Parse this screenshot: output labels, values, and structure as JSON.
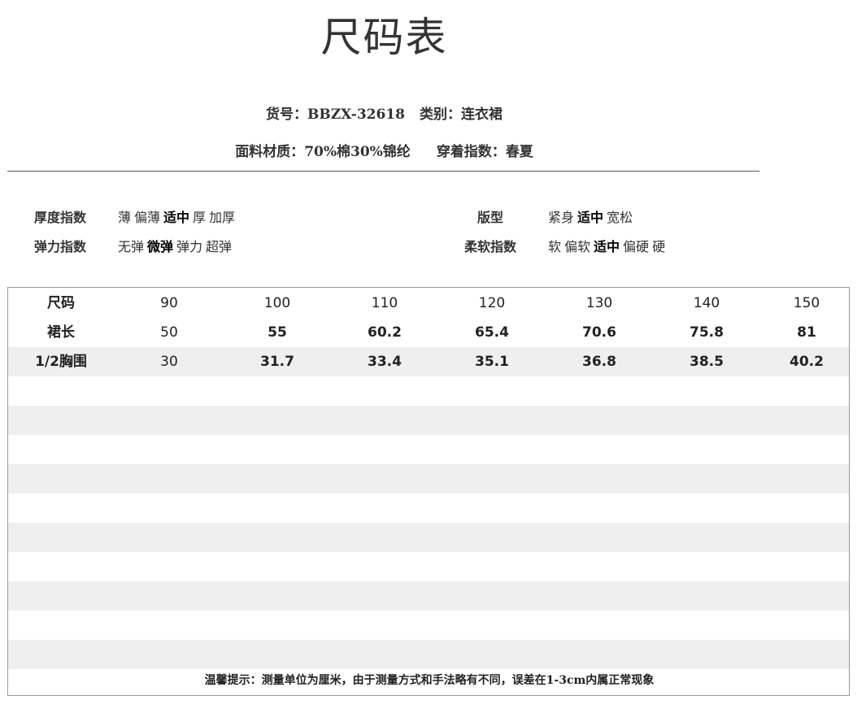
{
  "title": "尺码表",
  "meta": {
    "item_no_label": "货号：",
    "item_no": "BBZX-32618",
    "category_label": "类别：",
    "category": "连衣裙",
    "fabric_label": "面料材质：",
    "fabric": "70%棉30%锦纶",
    "season_label": "穿着指数：",
    "season": "春夏"
  },
  "attributes": {
    "thickness": {
      "label": "厚度指数",
      "options": [
        "薄",
        "偏薄",
        "适中",
        "厚",
        "加厚"
      ],
      "selected": "适中"
    },
    "elasticity": {
      "label": "弹力指数",
      "options": [
        "无弹",
        "微弹",
        "弹力",
        "超弹"
      ],
      "selected": "微弹"
    },
    "fit": {
      "label": "版型",
      "options": [
        "紧身",
        "适中",
        "宽松"
      ],
      "selected": "适中"
    },
    "softness": {
      "label": "柔软指数",
      "options": [
        "软",
        "偏软",
        "适中",
        "偏硬",
        "硬"
      ],
      "selected": "适中"
    }
  },
  "size_table": {
    "rows": [
      {
        "label": "尺码",
        "values": [
          "90",
          "100",
          "110",
          "120",
          "130",
          "140",
          "150"
        ]
      },
      {
        "label": "裙长",
        "values": [
          "50",
          "55",
          "60.2",
          "65.4",
          "70.6",
          "75.8",
          "81"
        ]
      },
      {
        "label": "1/2胸围",
        "values": [
          "30",
          "31.7",
          "33.4",
          "35.1",
          "36.8",
          "38.5",
          "40.2"
        ]
      }
    ]
  },
  "footer_note": "温馨提示：测量单位为厘米，由于测量方式和手法略有不同，误差在1-3cm内属正常现象"
}
